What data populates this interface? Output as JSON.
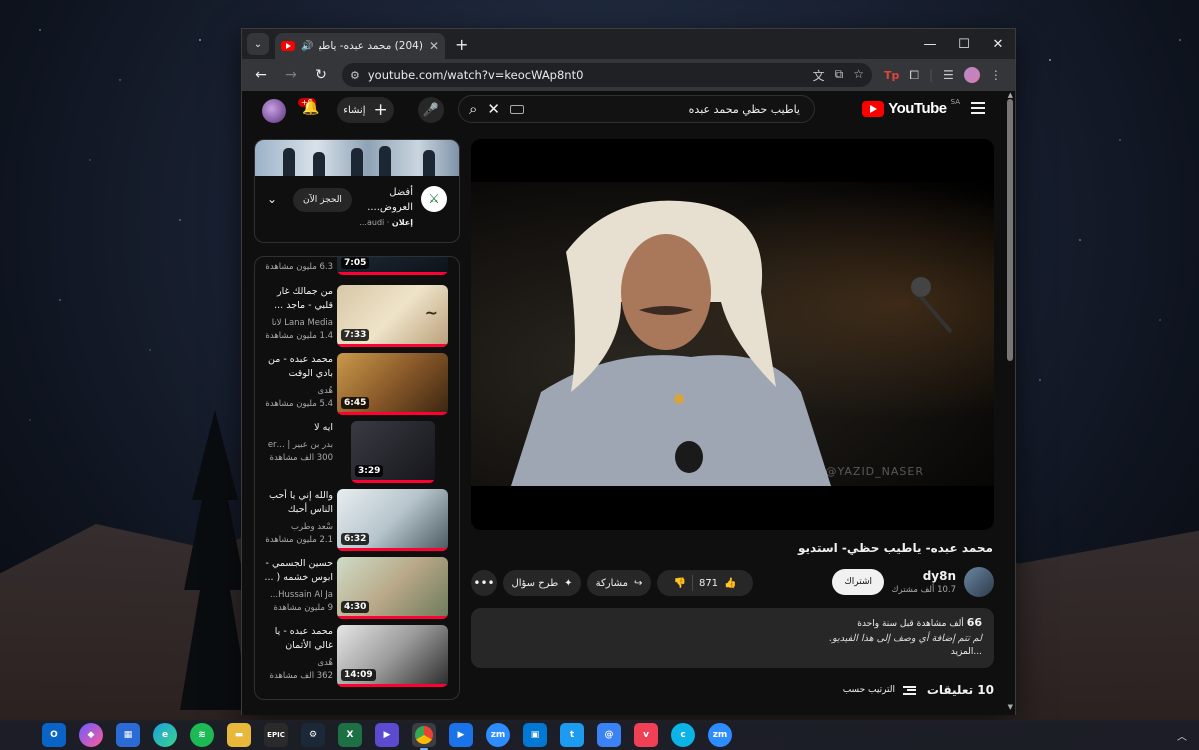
{
  "browser": {
    "tab_title": "(204) محمد عبده- ياطيب حظـ",
    "tab_dropdown": "⌄",
    "new_tab": "+",
    "url": "youtube.com/watch?v=keocWAp8nt0",
    "controls": {
      "minimize": "—",
      "maximize": "☐",
      "close": "✕"
    }
  },
  "youtube": {
    "logo_text": "YouTube",
    "region": "SA",
    "search_query": "ياطيب حظي محمد عبده",
    "create_label": "إنشاء",
    "notifications_count": "+9"
  },
  "ad": {
    "title": "أفضل العروض....",
    "label": "إعلان",
    "advertiser": "audi...",
    "cta": "الحجز الآن"
  },
  "recommendations": [
    {
      "title": "",
      "channel": "",
      "views": "6.3 مليون مشاهدة",
      "duration": "7:05"
    },
    {
      "title": "من جمالك غار قلبي - ماجد ...",
      "channel": "Lana Media لانا",
      "views": "1.4 مليون مشاهدة",
      "duration": "7:33"
    },
    {
      "title": "محمد عبده - من بادي الوقت",
      "channel": "هُدى",
      "views": "5.4 مليون مشاهدة",
      "duration": "6:45"
    },
    {
      "title": "ايه لا",
      "channel": "بدر بن عبير | ...er",
      "views": "300 ألف مشاهدة",
      "duration": "3:29"
    },
    {
      "title": "والله إني يا أحب الناس أحبك",
      "channel": "سْعد وطرب",
      "views": "2.1 مليون مشاهدة",
      "duration": "6:32"
    },
    {
      "title": "حسين الجسمي - ابوس خشمه ( ...",
      "channel": "Hussain Al Ja...",
      "views": "9 مليون مشاهدة",
      "duration": "4:30"
    },
    {
      "title": "محمد عبده - يا غالي الأثمان",
      "channel": "هُدى",
      "views": "362 ألف مشاهدة",
      "duration": "14:09"
    }
  ],
  "video": {
    "title": "محمد عبده- ياطيب حظي- استديو",
    "watermark": "@YAZID_NASER",
    "channel_name": "dy8n",
    "subscribers": "10.7 ألف مشترك",
    "subscribe_label": "اشتراك",
    "likes": "871",
    "share_label": "مشاركة",
    "ask_label": "طرح سؤال",
    "more_label": "•••"
  },
  "description": {
    "views": "66",
    "views_suffix": "ألف مشاهدة",
    "time": "قبل سنة واحدة",
    "text": "لم تتم إضافة أي وصف إلى هذا الفيديو.",
    "more": "...المزيد"
  },
  "comments": {
    "count_label": "10 تعليقات",
    "sort_label": "الترتيب حسب"
  },
  "taskbar": {
    "items": [
      "outlook-icon",
      "messenger-icon",
      "store-icon",
      "edge-icon",
      "spotify-icon",
      "files-icon",
      "epic-icon",
      "steam-icon",
      "excel-icon",
      "app-icon",
      "chrome-icon",
      "files-app-icon",
      "zoom-icon",
      "app2-icon",
      "twitter-icon",
      "app3-icon",
      "pocket-icon",
      "app4-icon",
      "zoom2-icon"
    ],
    "epic_label": "EPIC",
    "zm_label": "zm"
  }
}
